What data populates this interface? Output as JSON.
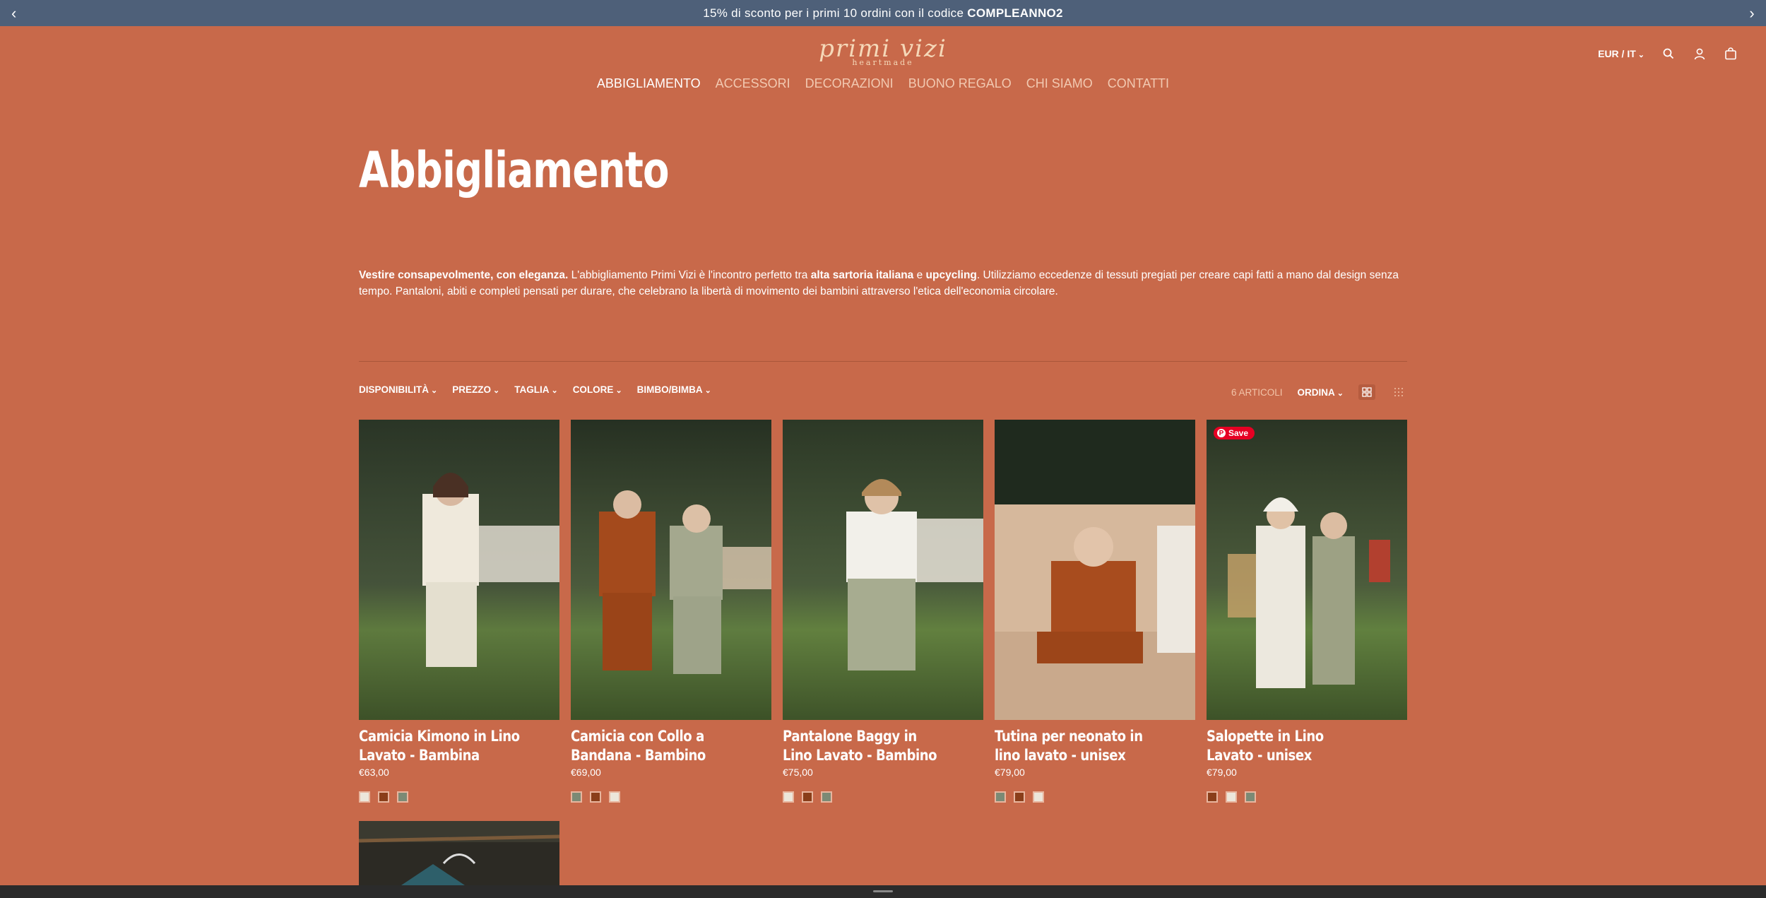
{
  "announcement": {
    "text": "15% di sconto per i primi 10 ordini con il codice ",
    "code": "COMPLEANNO2",
    "prev": "‹",
    "next": "›"
  },
  "logo": {
    "script": "primi vizi",
    "tagline": "heartmade"
  },
  "nav": [
    {
      "label": "ABBIGLIAMENTO"
    },
    {
      "label": "ACCESSORI"
    },
    {
      "label": "DECORAZIONI"
    },
    {
      "label": "BUONO REGALO"
    },
    {
      "label": "CHI SIAMO"
    },
    {
      "label": "CONTATTI"
    }
  ],
  "utils": {
    "currency": "EUR / IT"
  },
  "page": {
    "title": "Abbigliamento",
    "desc": {
      "b1": "Vestire consapevolmente, con eleganza.",
      "t1": " L'abbigliamento Primi Vizi è l'incontro perfetto tra ",
      "b2": "alta sartoria italiana",
      "t2": " e ",
      "b3": "upcycling",
      "t3": ". Utilizziamo eccedenze di tessuti pregiati per creare capi fatti a mano dal design senza tempo. Pantaloni, abiti e completi pensati per durare, che celebrano la libertà di movimento dei bambini attraverso l'etica dell'economia circolare."
    }
  },
  "filters": [
    "DISPONIBILITÀ",
    "PREZZO",
    "TAGLIA",
    "COLORE",
    "BIMBO/BIMBA"
  ],
  "sort": {
    "count": "6 ARTICOLI",
    "label": "ORDINA"
  },
  "pinterest": "Save",
  "products": [
    {
      "name_l1": "Camicia Kimono in Lino",
      "name_l2": "Lavato - Bambina",
      "price": "€63,00",
      "swatches": [
        "#ece6da",
        "#8a3e1a",
        "#7c8a75"
      ]
    },
    {
      "name_l1": "Camicia con Collo a",
      "name_l2": "Bandana - Bambino",
      "price": "€69,00",
      "swatches": [
        "#7c8a75",
        "#8a3e1a",
        "#ece6da"
      ]
    },
    {
      "name_l1": "Pantalone Baggy in",
      "name_l2": "Lino Lavato - Bambino",
      "price": "€75,00",
      "swatches": [
        "#ece6da",
        "#8a3e1a",
        "#7c8a75"
      ]
    },
    {
      "name_l1": "Tutina per neonato in",
      "name_l2": "lino lavato - unisex",
      "price": "€79,00",
      "swatches": [
        "#7c8a75",
        "#8a3e1a",
        "#ece6da"
      ]
    },
    {
      "name_l1": "Salopette in Lino",
      "name_l2": "Lavato - unisex",
      "price": "€79,00",
      "swatches": [
        "#8a3e1a",
        "#ece6da",
        "#7c8a75"
      ]
    }
  ],
  "colors": {
    "background": "#c8694a",
    "announcement": "#4e6079",
    "pinterest": "#e60023"
  }
}
